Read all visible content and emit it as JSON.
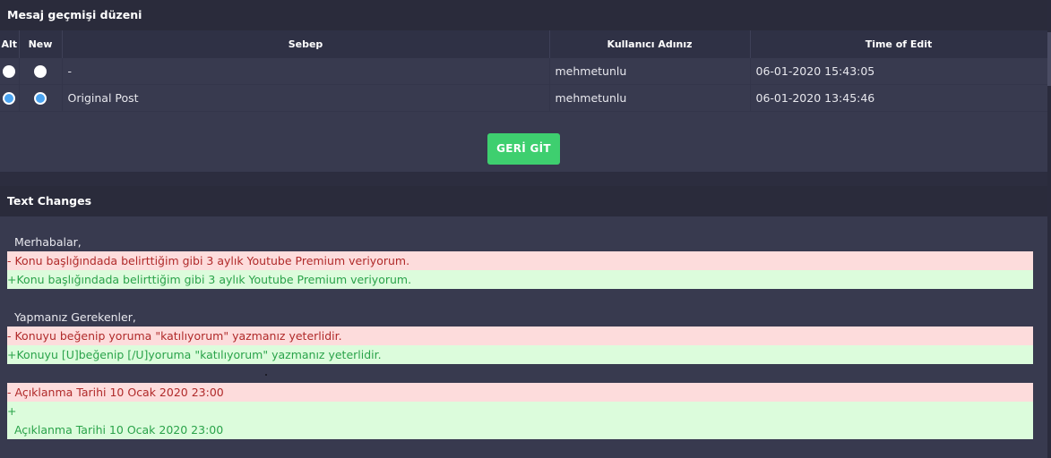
{
  "history": {
    "title": "Mesaj geçmişi düzeni",
    "columns": [
      "Alt",
      "New",
      "Sebep",
      "Kullanıcı Adınız",
      "Time of Edit"
    ],
    "rows": [
      {
        "reason": "-",
        "user": "mehmetunlu",
        "time": "06-01-2020 15:43:05",
        "alt_checked": false,
        "new_checked": false
      },
      {
        "reason": "Original Post",
        "user": "mehmetunlu",
        "time": "06-01-2020 13:45:46",
        "alt_checked": true,
        "new_checked": true
      }
    ],
    "back_button": "GERİ GİT"
  },
  "changes": {
    "title": "Text Changes",
    "lines": [
      {
        "type": "plain",
        "text": "  Merhabalar,"
      },
      {
        "type": "del",
        "text": "- Konu başlığındada belirttiğim gibi 3 aylık Youtube Premium veriyorum."
      },
      {
        "type": "ins",
        "text": "+Konu başlığındada belirttiğim gibi 3 aylık Youtube Premium veriyorum."
      },
      {
        "type": "spacer",
        "text": ""
      },
      {
        "type": "plain",
        "text": "  Yapmanız Gerekenler,"
      },
      {
        "type": "del",
        "text": "- Konuyu beğenip yoruma \"katılıyorum\" yazmanız yeterlidir."
      },
      {
        "type": "ins",
        "text": "+Konuyu [U]beğenip [/U]yoruma \"katılıyorum\" yazmanız yeterlidir."
      },
      {
        "type": "spacer",
        "text": ""
      },
      {
        "type": "del",
        "text": "- Açıklanma Tarihi 10 Ocak 2020 23:00"
      },
      {
        "type": "ins",
        "text": "+"
      },
      {
        "type": "ins",
        "text": "  Açıklanma Tarihi 10 Ocak 2020 23:00"
      }
    ]
  },
  "colors": {
    "background": "#2c2d3f",
    "panel": "#383a4f",
    "button": "#3ecf6f",
    "deleted_bg": "#fddcdc",
    "inserted_bg": "#dcfcdc",
    "radio_checked": "#4aa3f0"
  }
}
